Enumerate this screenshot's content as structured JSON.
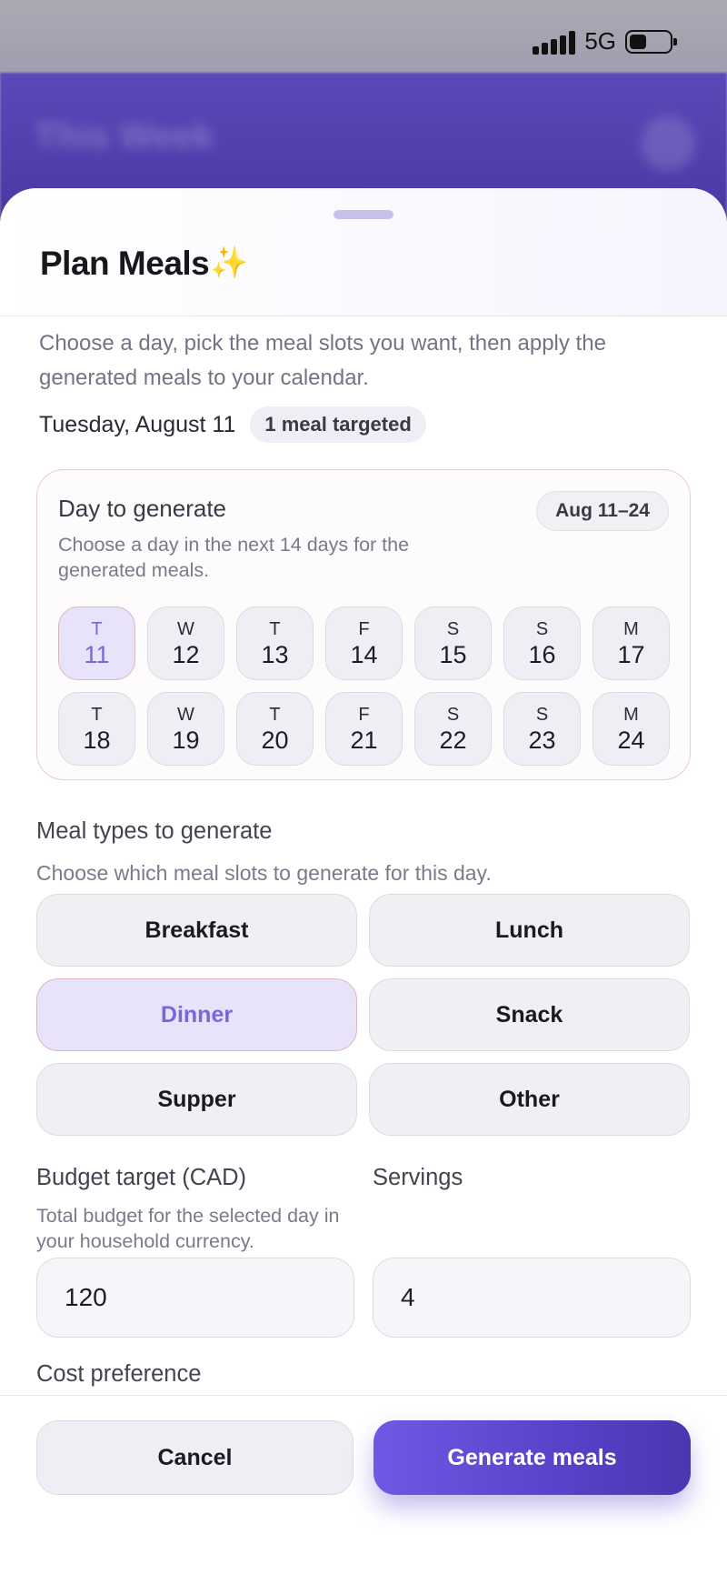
{
  "status_bar": {
    "network": "5G"
  },
  "background": {
    "title": "This Week"
  },
  "sheet": {
    "title": "Plan Meals",
    "title_emoji": "✨",
    "intro": "Choose a day, pick the meal slots you want, then apply the generated meals to your calendar.",
    "selected_date": "Tuesday, August 11",
    "targeted_badge": "1 meal targeted"
  },
  "day_card": {
    "title": "Day to generate",
    "subtitle": "Choose a day in the next 14 days for the generated meals.",
    "range": "Aug 11–24",
    "days": [
      {
        "dow": "T",
        "num": "11",
        "selected": true
      },
      {
        "dow": "W",
        "num": "12"
      },
      {
        "dow": "T",
        "num": "13"
      },
      {
        "dow": "F",
        "num": "14"
      },
      {
        "dow": "S",
        "num": "15"
      },
      {
        "dow": "S",
        "num": "16"
      },
      {
        "dow": "M",
        "num": "17"
      },
      {
        "dow": "T",
        "num": "18"
      },
      {
        "dow": "W",
        "num": "19"
      },
      {
        "dow": "T",
        "num": "20"
      },
      {
        "dow": "F",
        "num": "21"
      },
      {
        "dow": "S",
        "num": "22"
      },
      {
        "dow": "S",
        "num": "23"
      },
      {
        "dow": "M",
        "num": "24"
      }
    ]
  },
  "meal_types": {
    "title": "Meal types to generate",
    "subtitle": "Choose which meal slots to generate for this day.",
    "options": [
      {
        "label": "Breakfast"
      },
      {
        "label": "Lunch"
      },
      {
        "label": "Dinner",
        "selected": true
      },
      {
        "label": "Snack"
      },
      {
        "label": "Supper"
      },
      {
        "label": "Other"
      }
    ]
  },
  "budget": {
    "title": "Budget target (CAD)",
    "subtitle": "Total budget for the selected day in your household currency.",
    "value": "120"
  },
  "servings": {
    "title": "Servings",
    "value": "4"
  },
  "cost_preference": {
    "title": "Cost preference"
  },
  "footer": {
    "cancel_label": "Cancel",
    "generate_label": "Generate meals"
  },
  "colors": {
    "accent": "#6e59e3",
    "selected_bg": "#e8e3fa",
    "selected_text": "#7a66d8"
  }
}
